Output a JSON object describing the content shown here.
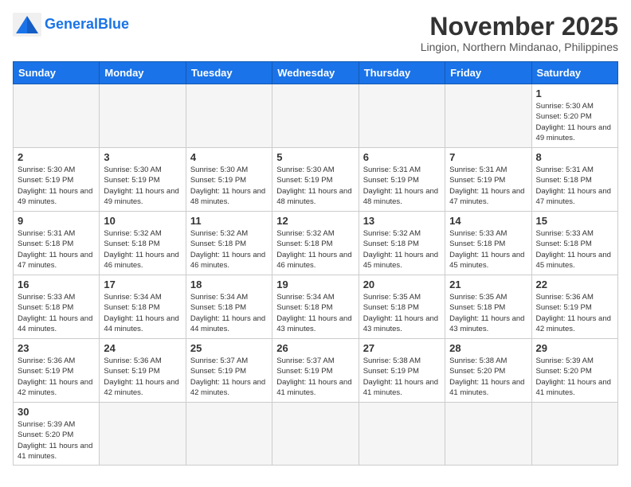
{
  "header": {
    "logo_general": "General",
    "logo_blue": "Blue",
    "month_title": "November 2025",
    "subtitle": "Lingion, Northern Mindanao, Philippines"
  },
  "days_of_week": [
    "Sunday",
    "Monday",
    "Tuesday",
    "Wednesday",
    "Thursday",
    "Friday",
    "Saturday"
  ],
  "weeks": [
    [
      {
        "day": "",
        "info": ""
      },
      {
        "day": "",
        "info": ""
      },
      {
        "day": "",
        "info": ""
      },
      {
        "day": "",
        "info": ""
      },
      {
        "day": "",
        "info": ""
      },
      {
        "day": "",
        "info": ""
      },
      {
        "day": "1",
        "info": "Sunrise: 5:30 AM\nSunset: 5:20 PM\nDaylight: 11 hours\nand 49 minutes."
      }
    ],
    [
      {
        "day": "2",
        "info": "Sunrise: 5:30 AM\nSunset: 5:19 PM\nDaylight: 11 hours\nand 49 minutes."
      },
      {
        "day": "3",
        "info": "Sunrise: 5:30 AM\nSunset: 5:19 PM\nDaylight: 11 hours\nand 49 minutes."
      },
      {
        "day": "4",
        "info": "Sunrise: 5:30 AM\nSunset: 5:19 PM\nDaylight: 11 hours\nand 48 minutes."
      },
      {
        "day": "5",
        "info": "Sunrise: 5:30 AM\nSunset: 5:19 PM\nDaylight: 11 hours\nand 48 minutes."
      },
      {
        "day": "6",
        "info": "Sunrise: 5:31 AM\nSunset: 5:19 PM\nDaylight: 11 hours\nand 48 minutes."
      },
      {
        "day": "7",
        "info": "Sunrise: 5:31 AM\nSunset: 5:19 PM\nDaylight: 11 hours\nand 47 minutes."
      },
      {
        "day": "8",
        "info": "Sunrise: 5:31 AM\nSunset: 5:18 PM\nDaylight: 11 hours\nand 47 minutes."
      }
    ],
    [
      {
        "day": "9",
        "info": "Sunrise: 5:31 AM\nSunset: 5:18 PM\nDaylight: 11 hours\nand 47 minutes."
      },
      {
        "day": "10",
        "info": "Sunrise: 5:32 AM\nSunset: 5:18 PM\nDaylight: 11 hours\nand 46 minutes."
      },
      {
        "day": "11",
        "info": "Sunrise: 5:32 AM\nSunset: 5:18 PM\nDaylight: 11 hours\nand 46 minutes."
      },
      {
        "day": "12",
        "info": "Sunrise: 5:32 AM\nSunset: 5:18 PM\nDaylight: 11 hours\nand 46 minutes."
      },
      {
        "day": "13",
        "info": "Sunrise: 5:32 AM\nSunset: 5:18 PM\nDaylight: 11 hours\nand 45 minutes."
      },
      {
        "day": "14",
        "info": "Sunrise: 5:33 AM\nSunset: 5:18 PM\nDaylight: 11 hours\nand 45 minutes."
      },
      {
        "day": "15",
        "info": "Sunrise: 5:33 AM\nSunset: 5:18 PM\nDaylight: 11 hours\nand 45 minutes."
      }
    ],
    [
      {
        "day": "16",
        "info": "Sunrise: 5:33 AM\nSunset: 5:18 PM\nDaylight: 11 hours\nand 44 minutes."
      },
      {
        "day": "17",
        "info": "Sunrise: 5:34 AM\nSunset: 5:18 PM\nDaylight: 11 hours\nand 44 minutes."
      },
      {
        "day": "18",
        "info": "Sunrise: 5:34 AM\nSunset: 5:18 PM\nDaylight: 11 hours\nand 44 minutes."
      },
      {
        "day": "19",
        "info": "Sunrise: 5:34 AM\nSunset: 5:18 PM\nDaylight: 11 hours\nand 43 minutes."
      },
      {
        "day": "20",
        "info": "Sunrise: 5:35 AM\nSunset: 5:18 PM\nDaylight: 11 hours\nand 43 minutes."
      },
      {
        "day": "21",
        "info": "Sunrise: 5:35 AM\nSunset: 5:18 PM\nDaylight: 11 hours\nand 43 minutes."
      },
      {
        "day": "22",
        "info": "Sunrise: 5:36 AM\nSunset: 5:19 PM\nDaylight: 11 hours\nand 42 minutes."
      }
    ],
    [
      {
        "day": "23",
        "info": "Sunrise: 5:36 AM\nSunset: 5:19 PM\nDaylight: 11 hours\nand 42 minutes."
      },
      {
        "day": "24",
        "info": "Sunrise: 5:36 AM\nSunset: 5:19 PM\nDaylight: 11 hours\nand 42 minutes."
      },
      {
        "day": "25",
        "info": "Sunrise: 5:37 AM\nSunset: 5:19 PM\nDaylight: 11 hours\nand 42 minutes."
      },
      {
        "day": "26",
        "info": "Sunrise: 5:37 AM\nSunset: 5:19 PM\nDaylight: 11 hours\nand 41 minutes."
      },
      {
        "day": "27",
        "info": "Sunrise: 5:38 AM\nSunset: 5:19 PM\nDaylight: 11 hours\nand 41 minutes."
      },
      {
        "day": "28",
        "info": "Sunrise: 5:38 AM\nSunset: 5:20 PM\nDaylight: 11 hours\nand 41 minutes."
      },
      {
        "day": "29",
        "info": "Sunrise: 5:39 AM\nSunset: 5:20 PM\nDaylight: 11 hours\nand 41 minutes."
      }
    ],
    [
      {
        "day": "30",
        "info": "Sunrise: 5:39 AM\nSunset: 5:20 PM\nDaylight: 11 hours\nand 41 minutes."
      },
      {
        "day": "",
        "info": ""
      },
      {
        "day": "",
        "info": ""
      },
      {
        "day": "",
        "info": ""
      },
      {
        "day": "",
        "info": ""
      },
      {
        "day": "",
        "info": ""
      },
      {
        "day": "",
        "info": ""
      }
    ]
  ]
}
